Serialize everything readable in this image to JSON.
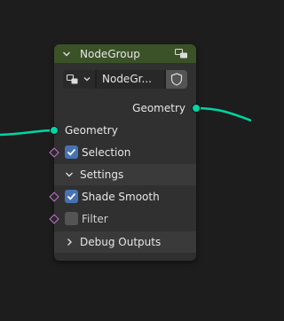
{
  "node": {
    "title": "NodeGroup",
    "group_name": "NodeGr...",
    "output_label": "Geometry",
    "inputs": {
      "geometry": "Geometry",
      "selection": "Selection",
      "settings_panel": "Settings",
      "shade_smooth": "Shade Smooth",
      "filter": "Filter",
      "debug_panel": "Debug Outputs"
    },
    "values": {
      "selection": true,
      "shade_smooth": true,
      "filter": false,
      "settings_expanded": true,
      "debug_expanded": false
    }
  },
  "colors": {
    "background": "#1d1d1d",
    "node_body": "#303030",
    "header": "#3b5228",
    "geometry_socket": "#00d6a3",
    "boolean_socket": "#c873d6",
    "checkbox_on": "#4772b3"
  },
  "icons": [
    "chevron-down-icon",
    "node-tree-icon",
    "shield-icon",
    "checkmark-icon",
    "chevron-right-icon"
  ]
}
